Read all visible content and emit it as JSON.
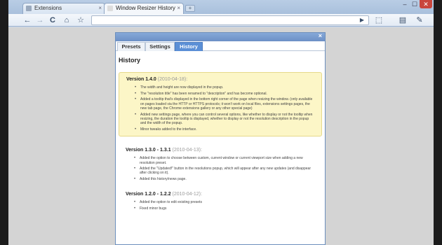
{
  "browser": {
    "tabs": [
      {
        "label": "Extensions"
      },
      {
        "label": "Window Resizer History"
      }
    ],
    "new_tab_label": "+",
    "window_controls": {
      "minimize": "–",
      "maximize": "☐",
      "close": "✕"
    },
    "nav": {
      "back": "←",
      "forward": "→",
      "reload": "C",
      "home": "⌂",
      "star": "☆"
    },
    "toolbar_right": {
      "play": "▶",
      "resize": "⬚",
      "page": "▤",
      "wrench": "✎"
    }
  },
  "popup": {
    "close": "×",
    "tabs": [
      {
        "label": "Presets"
      },
      {
        "label": "Settings"
      },
      {
        "label": "History",
        "active": true
      }
    ],
    "title": "History",
    "versions": [
      {
        "version": "Version 1.4.0",
        "date": "(2010-04-18):",
        "items": [
          "The width and height are now displayed in the popup.",
          "The \"resolution title\" has been renamed to \"description\" and has become optional.",
          "Added a tooltip that's displayed in the bottom right corner of the page when resizing the window. (only available on pages loaded via the HTTP or HTTPS protocols; it won't work on local files, extensions settings pages, the new tab page, the Chrome extensions gallery or any other special page)",
          "Added new settings page, where you can control several options, like whether to display or not the tooltip when resizing, the duration the tooltip is displayed, whether to display or not the resolution description in the popup and the width of the popup.",
          "Minor tweaks added to the interface."
        ]
      },
      {
        "version": "Version 1.3.0 - 1.3.1",
        "date": "(2010-04-13):",
        "items": [
          "Added the option to choose between custom, current window or current viewport size when adding a new resolution preset.",
          "Added the \"Updated!\" button in the resolutions popup, which will appear after any new updates (and disappear after clicking on it).",
          "Added this history/news page."
        ]
      },
      {
        "version": "Version 1.2.0 - 1.2.2",
        "date": "(2010-04-12):",
        "items": [
          "Added the option to edit existing presets",
          "Fixed minor bugs"
        ]
      }
    ]
  }
}
